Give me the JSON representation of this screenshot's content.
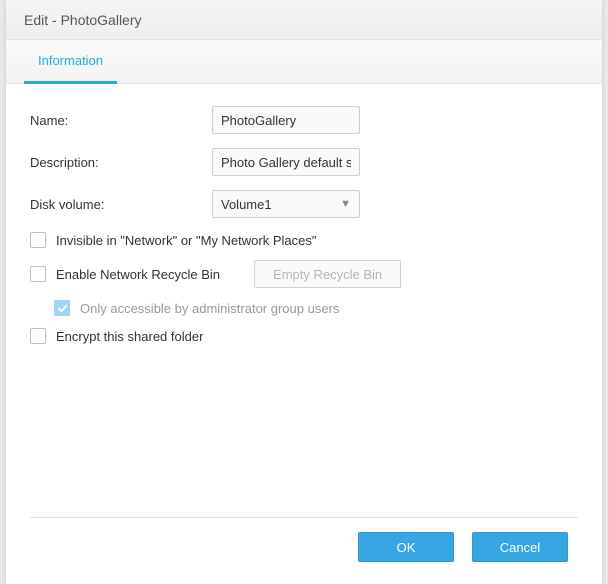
{
  "dialog": {
    "title": "Edit - PhotoGallery"
  },
  "tabs": {
    "information": "Information"
  },
  "form": {
    "name_label": "Name:",
    "name_value": "PhotoGallery",
    "description_label": "Description:",
    "description_value": "Photo Gallery default sh",
    "disk_volume_label": "Disk volume:",
    "disk_volume_value": "Volume1",
    "invisible_label": "Invisible in \"Network\" or \"My Network Places\"",
    "recycle_label": "Enable Network Recycle Bin",
    "empty_recycle_btn": "Empty Recycle Bin",
    "admin_only_label": "Only accessible by administrator group users",
    "encrypt_label": "Encrypt this shared folder"
  },
  "footer": {
    "ok": "OK",
    "cancel": "Cancel"
  }
}
